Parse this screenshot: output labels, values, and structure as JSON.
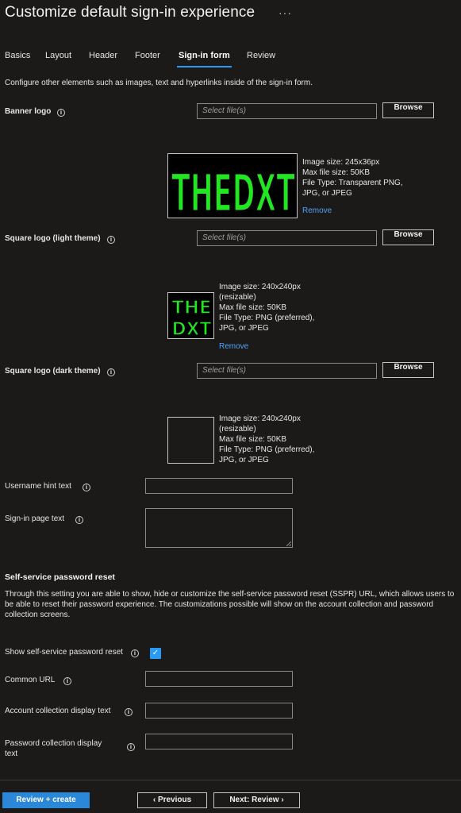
{
  "header": {
    "title": "Customize default sign-in experience",
    "more_label": "···"
  },
  "tabs": [
    {
      "label": "Basics"
    },
    {
      "label": "Layout"
    },
    {
      "label": "Header"
    },
    {
      "label": "Footer"
    },
    {
      "label": "Sign-in form",
      "active": true
    },
    {
      "label": "Review"
    }
  ],
  "description": "Configure other elements such as images, text and hyperlinks inside of the sign-in form.",
  "info_glyph": "i",
  "banner_logo": {
    "label": "Banner logo",
    "placeholder": "Select file(s)",
    "browse_label": "Browse",
    "logo_text": "THEDXT",
    "meta": [
      "Image size: 245x36px",
      "Max file size: 50KB",
      "File Type: Transparent PNG,",
      "JPG, or JPEG"
    ],
    "remove_label": "Remove"
  },
  "square_logo_light": {
    "label": "Square logo (light theme)",
    "placeholder": "Select file(s)",
    "browse_label": "Browse",
    "logo_line1": "THE",
    "logo_line2": "DXT",
    "meta": [
      "Image size: 240x240px",
      "(resizable)",
      "Max file size: 50KB",
      "File Type: PNG (preferred),",
      "JPG, or JPEG"
    ],
    "remove_label": "Remove"
  },
  "square_logo_dark": {
    "label": "Square logo (dark theme)",
    "placeholder": "Select file(s)",
    "browse_label": "Browse",
    "meta": [
      "Image size: 240x240px",
      "(resizable)",
      "Max file size: 50KB",
      "File Type: PNG (preferred),",
      "JPG, or JPEG"
    ]
  },
  "username_hint": {
    "label": "Username hint text",
    "value": ""
  },
  "signin_page_text": {
    "label": "Sign-in page text",
    "value": ""
  },
  "sspr": {
    "heading": "Self-service password reset",
    "paragraph": "Through this setting you are able to show, hide or customize the self-service password reset (SSPR) URL, which allows users to be able to reset their password experience. The customizations possible will show on the account collection and password collection screens.",
    "show_label": "Show self-service password reset",
    "show_checked": true,
    "check_glyph": "✓",
    "common_url_label": "Common URL",
    "account_collection_label": "Account collection display text",
    "password_collection_label_line1": "Password collection display",
    "password_collection_label_line2": "text"
  },
  "footer": {
    "review_create_label": "Review + create",
    "previous_label": "Previous",
    "next_label": "Next: Review"
  },
  "colors": {
    "background": "#1b1a19",
    "accent": "#2899f5",
    "primary_button": "#2b88d8",
    "logo_green": "#22e622"
  }
}
